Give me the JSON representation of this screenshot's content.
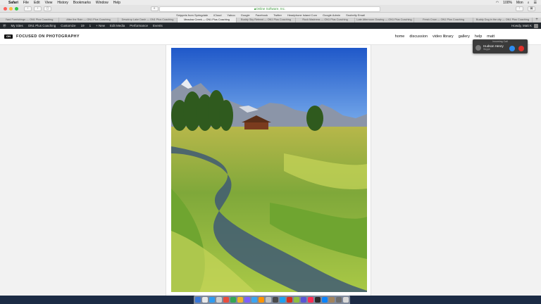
{
  "menubar": {
    "apple_icon": "apple-icon",
    "items": [
      "Safari",
      "File",
      "Edit",
      "View",
      "History",
      "Bookmarks",
      "Window",
      "Help"
    ],
    "battery": "100%",
    "clock": "Mon"
  },
  "toolbar": {
    "address": "Online Software, Inc."
  },
  "favorites": [
    "Snippets from Springdale",
    "iCloud",
    "Yahoo",
    "Google",
    "Facebook",
    "Twitter",
    "Headphone Island Com",
    "Google Admin",
    "Snobelty Email"
  ],
  "tabs": [
    {
      "label": "Yard Furnishings — ON1 Plus Coaching",
      "active": false
    },
    {
      "label": "After the Rain — ON1 Plus Coaching",
      "active": false
    },
    {
      "label": "Dewdrop Lake Dash — ON1 Plus Coaching",
      "active": false
    },
    {
      "label": "Meadow Creek — ON1 Plus Coaching",
      "active": true
    },
    {
      "label": "Buddy Sky Retreat — ON1 Plus Coaching",
      "active": false
    },
    {
      "label": "Rock Madness — ON1 Plus Coaching",
      "active": false
    },
    {
      "label": "Late Afternoon Grazing — ON1 Plus Coaching",
      "active": false
    },
    {
      "label": "Fresh Crow — ON1 Plus Coaching",
      "active": false
    },
    {
      "label": "Buddy Dog in the city — ON1 Plus Coaching",
      "active": false
    }
  ],
  "adminbar": {
    "items": [
      "My Sites",
      "ON1 Plus Coaching",
      "Customize",
      "19",
      "1",
      "+ New",
      "Edit Media",
      "Performance",
      "Events"
    ],
    "greeting": "Howdy, Matt K"
  },
  "site": {
    "logo": "ON",
    "name": "FOCUSED ON PHOTOGRAPHY",
    "nav": [
      "home",
      "discussion",
      "video library",
      "gallery",
      "help",
      "matt"
    ]
  },
  "call": {
    "title": "Incoming Call",
    "name": "Hudson Henry",
    "sub": "Skype"
  },
  "dock": {
    "apps": [
      "#3a78d8",
      "#e8e8e8",
      "#2f9bf0",
      "#cfcfcf",
      "#e94d3d",
      "#34a853",
      "#f0b429",
      "#7d5fff",
      "#3aa6f2",
      "#ff9500",
      "#c0c0c0",
      "#4a4a4a",
      "#1da1f2",
      "#d62d20",
      "#8fbf3f",
      "#5856d6",
      "#ff2d55",
      "#2b2b2b",
      "#0a84ff",
      "#a2845e",
      "#6e6e6e",
      "#d9d9d9"
    ]
  }
}
